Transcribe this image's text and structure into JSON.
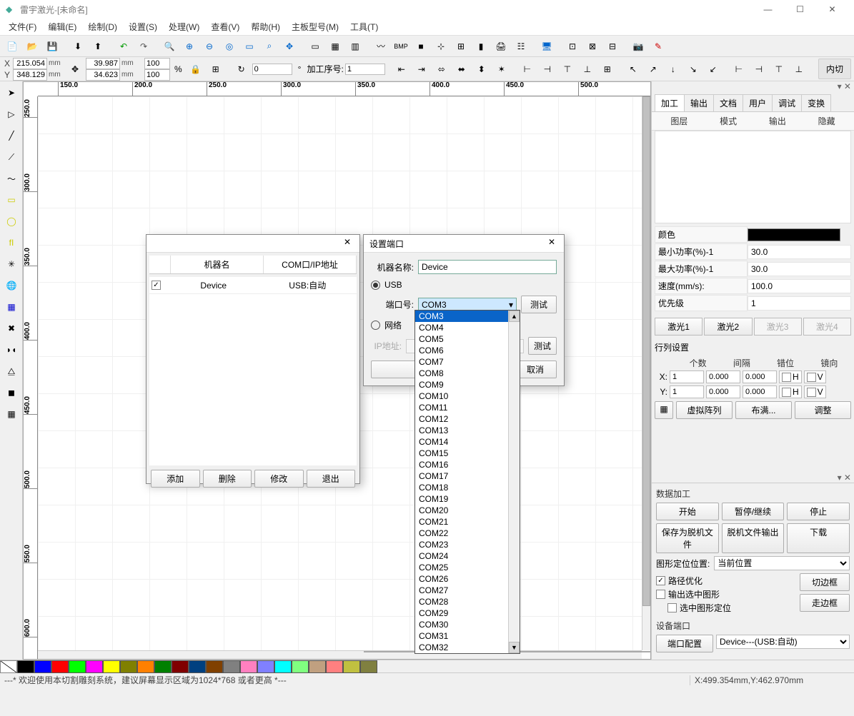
{
  "title": "雷宇激光-[未命名]",
  "menu": [
    "文件(F)",
    "编辑(E)",
    "绘制(D)",
    "设置(S)",
    "处理(W)",
    "查看(V)",
    "帮助(H)",
    "主板型号(M)",
    "工具(T)"
  ],
  "coords": {
    "x": "215.054",
    "y": "348.129",
    "w": "39.987",
    "h": "34.623",
    "unit": "mm",
    "sx": "100",
    "sy": "100",
    "pct": "%",
    "angle": "0",
    "seq_label": "加工序号:",
    "seq_val": "1",
    "inner_cut": "内切"
  },
  "ruler_h": [
    "150.0",
    "200.0",
    "250.0",
    "300.0",
    "350.0",
    "400.0",
    "450.0",
    "500.0"
  ],
  "ruler_v": [
    "250.0",
    "300.0",
    "350.0",
    "400.0",
    "450.0",
    "500.0",
    "550.0",
    "600.0"
  ],
  "right": {
    "tabs": [
      "加工",
      "输出",
      "文档",
      "用户",
      "调试",
      "变换"
    ],
    "cols": [
      "图层",
      "模式",
      "输出",
      "隐藏"
    ],
    "props": {
      "color": "颜色",
      "minp": {
        "label": "最小功率(%)-1",
        "val": "30.0"
      },
      "maxp": {
        "label": "最大功率(%)-1",
        "val": "30.0"
      },
      "speed": {
        "label": "速度(mm/s):",
        "val": "100.0"
      },
      "prio": {
        "label": "优先级",
        "val": "1"
      }
    },
    "lasers": [
      "激光1",
      "激光2",
      "激光3",
      "激光4"
    ],
    "matrix": {
      "title": "行列设置",
      "heads": [
        "个数",
        "间隔",
        "错位",
        "镜向"
      ],
      "x": {
        "count": "1",
        "gap": "0.000",
        "off": "0.000"
      },
      "y": {
        "count": "1",
        "gap": "0.000",
        "off": "0.000"
      },
      "h": "H",
      "v": "V",
      "btns": [
        "虚拟阵列",
        "布满...",
        "调整"
      ]
    }
  },
  "data_proc": {
    "title": "数据加工",
    "row1": [
      "开始",
      "暂停/继续",
      "停止"
    ],
    "row2": [
      "保存为脱机文件",
      "脱机文件输出",
      "下载"
    ],
    "pos_label": "图形定位位置:",
    "pos_val": "当前位置",
    "cb1": "路径优化",
    "cb2": "输出选中图形",
    "cb3": "选中图形定位",
    "btn_cut": "切边框",
    "btn_go": "走边框",
    "port_title": "设备端口",
    "port_btn": "端口配置",
    "port_val": "Device---(USB:自动)"
  },
  "dlg1": {
    "cols": [
      "机器名",
      "COM口/IP地址"
    ],
    "row": {
      "name": "Device",
      "port": "USB:自动"
    },
    "btns": [
      "添加",
      "删除",
      "修改",
      "退出"
    ]
  },
  "dlg2": {
    "title": "设置端口",
    "name_label": "机器名称:",
    "name_val": "Device",
    "usb": "USB",
    "net": "网络",
    "port_label": "端口号:",
    "port_val": "COM3",
    "ip_label": "IP地址:",
    "test": "测试",
    "cancel": "取消"
  },
  "com_list": [
    "COM3",
    "COM4",
    "COM5",
    "COM6",
    "COM7",
    "COM8",
    "COM9",
    "COM10",
    "COM11",
    "COM12",
    "COM13",
    "COM14",
    "COM15",
    "COM16",
    "COM17",
    "COM18",
    "COM19",
    "COM20",
    "COM21",
    "COM22",
    "COM23",
    "COM24",
    "COM25",
    "COM26",
    "COM27",
    "COM28",
    "COM29",
    "COM30",
    "COM31",
    "COM32"
  ],
  "palette": [
    "#000000",
    "#0000ff",
    "#ff0000",
    "#00ff00",
    "#ff00ff",
    "#ffff00",
    "#808000",
    "#ff8000",
    "#008000",
    "#800000",
    "#004080",
    "#804000",
    "#808080",
    "#ff80c0",
    "#8080ff",
    "#00ffff",
    "#80ff80",
    "#c0a080",
    "#ff8080",
    "#c0c040",
    "#808040"
  ],
  "status": {
    "left": "---* 欢迎使用本切割雕刻系统，建议屏幕显示区域为1024*768 或者更高 *---",
    "right": "X:499.354mm,Y:462.970mm"
  }
}
